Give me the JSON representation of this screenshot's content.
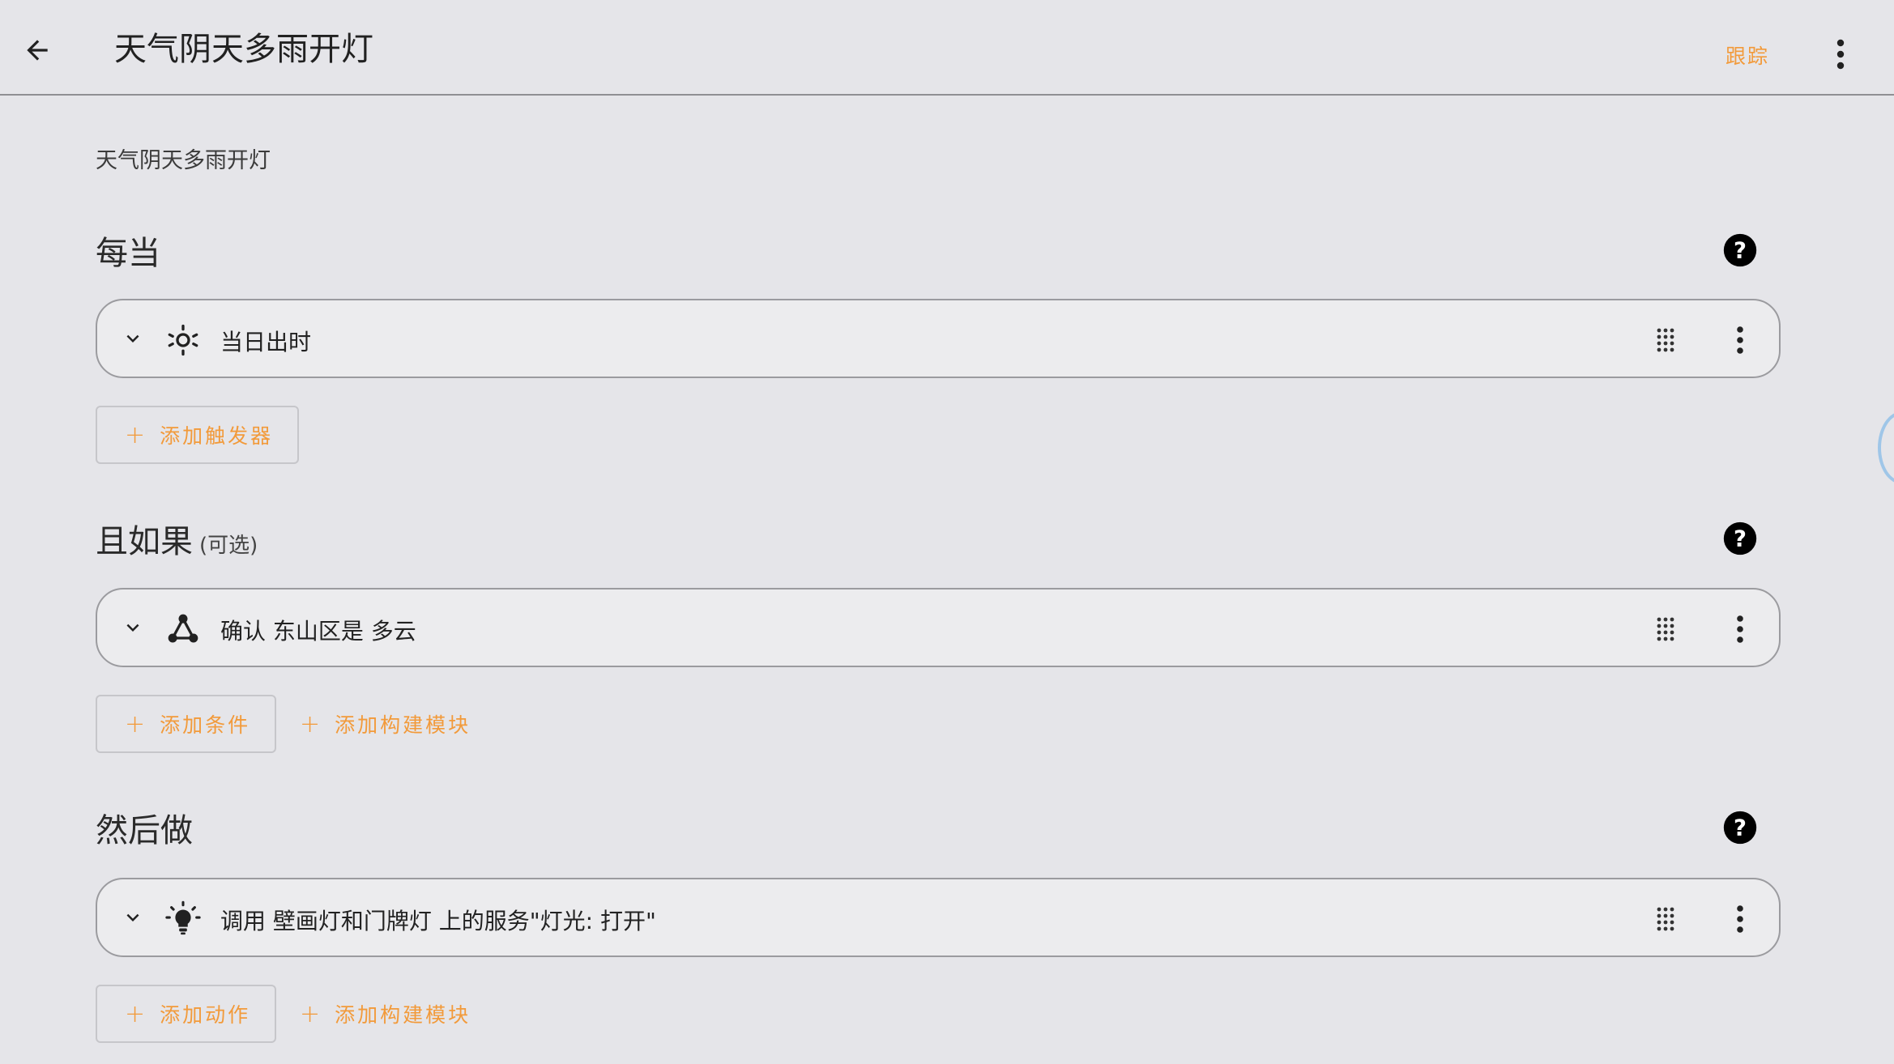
{
  "header": {
    "title": "天气阴天多雨开灯",
    "trace_label": "跟踪"
  },
  "description": "天气阴天多雨开灯",
  "triggers": {
    "title": "每当",
    "items": [
      {
        "label": "当日出时",
        "icon": "sun-icon"
      }
    ],
    "add_label": "添加触发器"
  },
  "conditions": {
    "title": "且如果",
    "optional_label": "(可选)",
    "items": [
      {
        "label": "确认 东山区是 多云",
        "icon": "state-condition-icon"
      }
    ],
    "add_label": "添加条件",
    "add_block_label": "添加构建模块"
  },
  "actions": {
    "title": "然后做",
    "items": [
      {
        "label": "调用 壁画灯和门牌灯 上的服务\"灯光: 打开\"",
        "icon": "lightbulb-icon"
      }
    ],
    "add_label": "添加动作",
    "add_block_label": "添加构建模块"
  },
  "colors": {
    "accent": "#f29a3a",
    "background": "#e5e5e9",
    "card": "#ececee",
    "card_border": "#9b9b9f"
  }
}
